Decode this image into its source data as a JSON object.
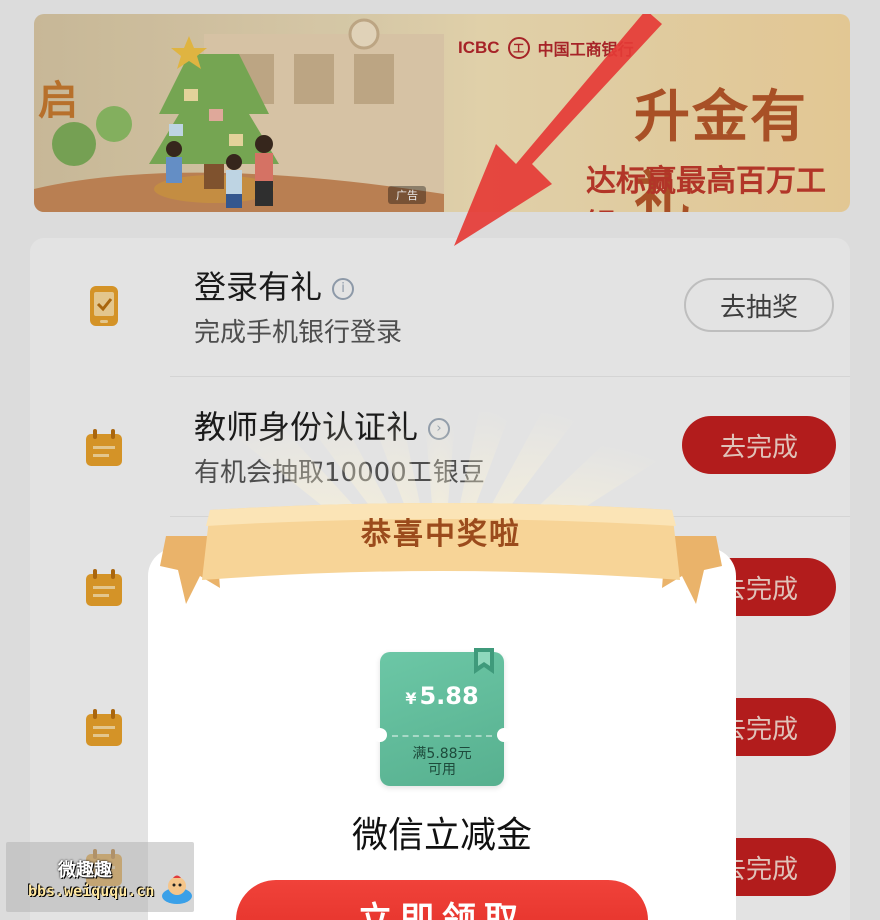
{
  "banner": {
    "left_partial_text": "启",
    "bank_logo": {
      "latin": "ICBC",
      "seal": "工",
      "name": "中国工商银行"
    },
    "title": "升金有礼",
    "subtitle": "达标赢最高百万工银",
    "ad_tag": "广告"
  },
  "tasks": [
    {
      "title": "登录有礼",
      "desc": "完成手机银行登录",
      "button": "去抽奖",
      "icon": "phone-check-icon",
      "style": "outline"
    },
    {
      "title": "教师身份认证礼",
      "desc": "有机会抽取10000工银豆",
      "button": "去完成",
      "icon": "calendar-icon",
      "style": "red"
    },
    {
      "title": "",
      "desc": "",
      "button": "去完成",
      "icon": "calendar-icon",
      "style": "red"
    },
    {
      "title": "",
      "desc": "",
      "button": "去完成",
      "icon": "calendar-icon",
      "style": "red"
    },
    {
      "title": "",
      "desc": "",
      "button": "去完成",
      "icon": "calendar-icon",
      "style": "red"
    }
  ],
  "modal": {
    "title": "恭喜中奖啦",
    "coupon": {
      "currency": "¥",
      "amount": "5.88",
      "condition_line1": "满5.88元",
      "condition_line2": "可用"
    },
    "prize_name": "微信立减金",
    "claim_button": "立即领取"
  },
  "watermark": {
    "title": "微趣趣",
    "url": "bbs.weiququ.cn"
  },
  "colors": {
    "primary_red": "#c21f1f",
    "claim_red": "#e12d25",
    "coupon_green": "#5fb896",
    "ribbon_gold": "#f2c987",
    "icon_orange": "#e7a02b"
  }
}
